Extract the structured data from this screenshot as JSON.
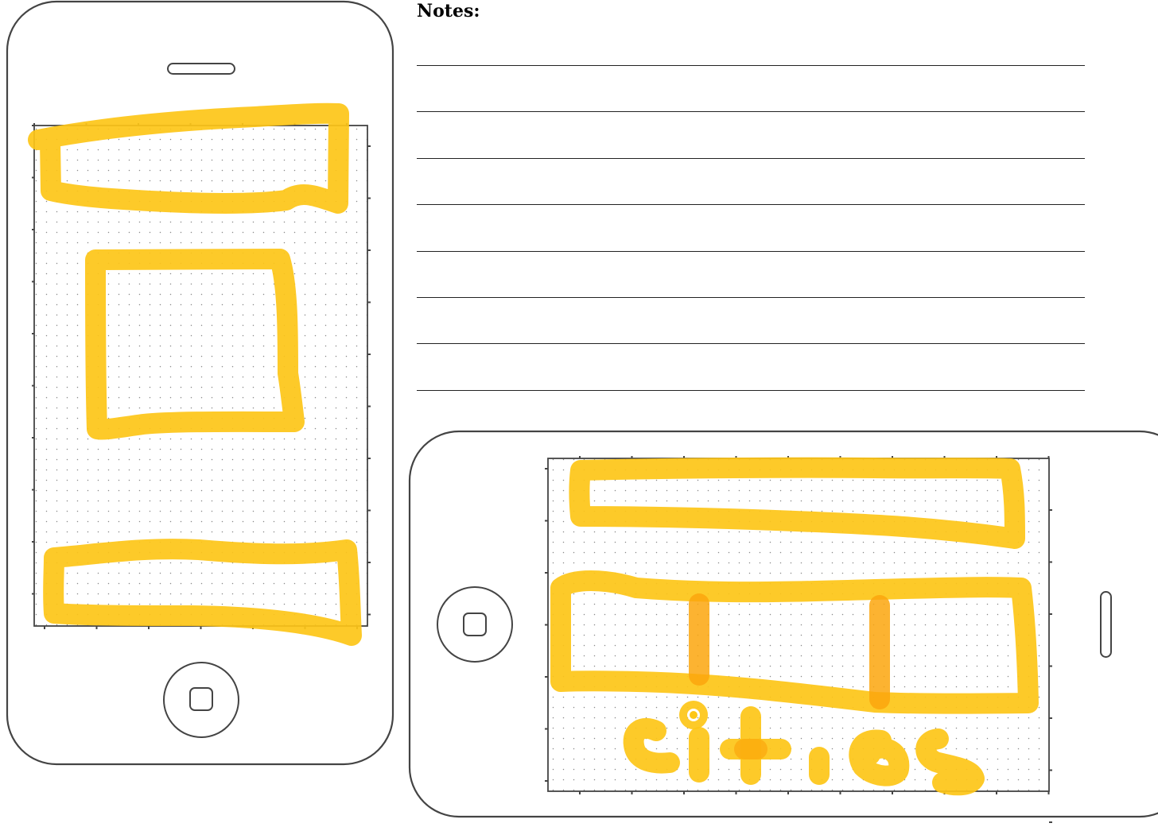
{
  "notes": {
    "title": "Notes:",
    "line_count": 8
  },
  "colors": {
    "highlighter_yellow": "#fdc617",
    "highlighter_overlap": "#fba60d",
    "device_outline": "#444444",
    "grid_dot": "#8a8a8a",
    "note_line": "#222222"
  },
  "devices": {
    "portrait": {
      "orientation": "portrait",
      "home_button_icon": "home-button-icon",
      "speaker_icon": "speaker-slot-icon"
    },
    "landscape": {
      "orientation": "landscape",
      "home_button_icon": "home-button-icon",
      "speaker_icon": "speaker-slot-icon",
      "handwritten_text": "cities"
    }
  }
}
